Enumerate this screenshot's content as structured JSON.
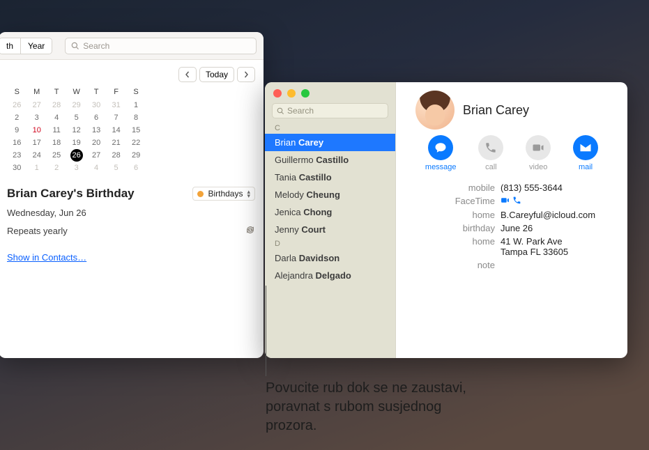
{
  "calendar": {
    "tabs": {
      "month": "th",
      "year": "Year"
    },
    "search_placeholder": "Search",
    "today_label": "Today",
    "dow": [
      "S",
      "M",
      "T",
      "W",
      "T",
      "F",
      "S"
    ],
    "grid": [
      [
        {
          "d": 26,
          "o": true
        },
        {
          "d": 27,
          "o": true
        },
        {
          "d": 28,
          "o": true
        },
        {
          "d": 29,
          "o": true
        },
        {
          "d": 30,
          "o": true
        },
        {
          "d": 31,
          "o": true
        },
        {
          "d": 1
        }
      ],
      [
        {
          "d": 2
        },
        {
          "d": 3
        },
        {
          "d": 4
        },
        {
          "d": 5
        },
        {
          "d": 6
        },
        {
          "d": 7
        },
        {
          "d": 8
        }
      ],
      [
        {
          "d": 9
        },
        {
          "d": 10,
          "h": true
        },
        {
          "d": 11
        },
        {
          "d": 12
        },
        {
          "d": 13
        },
        {
          "d": 14
        },
        {
          "d": 15
        }
      ],
      [
        {
          "d": 16
        },
        {
          "d": 17
        },
        {
          "d": 18
        },
        {
          "d": 19
        },
        {
          "d": 20
        },
        {
          "d": 21
        },
        {
          "d": 22
        }
      ],
      [
        {
          "d": 23
        },
        {
          "d": 24
        },
        {
          "d": 25
        },
        {
          "d": 26,
          "t": true
        },
        {
          "d": 27
        },
        {
          "d": 28
        },
        {
          "d": 29
        }
      ],
      [
        {
          "d": 30
        },
        {
          "d": 1,
          "o": true
        },
        {
          "d": 2,
          "o": true
        },
        {
          "d": 3,
          "o": true
        },
        {
          "d": 4,
          "o": true
        },
        {
          "d": 5,
          "o": true
        },
        {
          "d": 6,
          "o": true
        }
      ]
    ],
    "event": {
      "title": "Brian Carey's Birthday",
      "calendar_name": "Birthdays",
      "date_line": "Wednesday, Jun 26",
      "repeat_line": "Repeats yearly",
      "show_link": "Show in Contacts…"
    }
  },
  "contacts": {
    "search_placeholder": "Search",
    "sections": [
      {
        "letter": "C",
        "items": [
          {
            "first": "Brian",
            "last": "Carey",
            "selected": true
          },
          {
            "first": "Guillermo",
            "last": "Castillo"
          },
          {
            "first": "Tania",
            "last": "Castillo"
          },
          {
            "first": "Melody",
            "last": "Cheung"
          },
          {
            "first": "Jenica",
            "last": "Chong"
          },
          {
            "first": "Jenny",
            "last": "Court"
          }
        ]
      },
      {
        "letter": "D",
        "items": [
          {
            "first": "Darla",
            "last": "Davidson"
          },
          {
            "first": "Alejandra",
            "last": "Delgado"
          }
        ]
      }
    ],
    "detail": {
      "name": "Brian Carey",
      "actions": {
        "message": "message",
        "call": "call",
        "video": "video",
        "mail": "mail"
      },
      "fields": [
        {
          "label": "mobile",
          "value": "(813) 555-3644"
        },
        {
          "label": "FaceTime",
          "value": "",
          "facetime": true
        },
        {
          "label": "home",
          "value": "B.Careyful@icloud.com"
        },
        {
          "label": "birthday",
          "value": "June 26"
        },
        {
          "label": "home",
          "value": "41 W. Park Ave\nTampa FL 33605"
        },
        {
          "label": "note",
          "value": ""
        }
      ]
    }
  },
  "callout": "Povucite rub dok se ne zaustavi, poravnat s rubom susjednog prozora."
}
